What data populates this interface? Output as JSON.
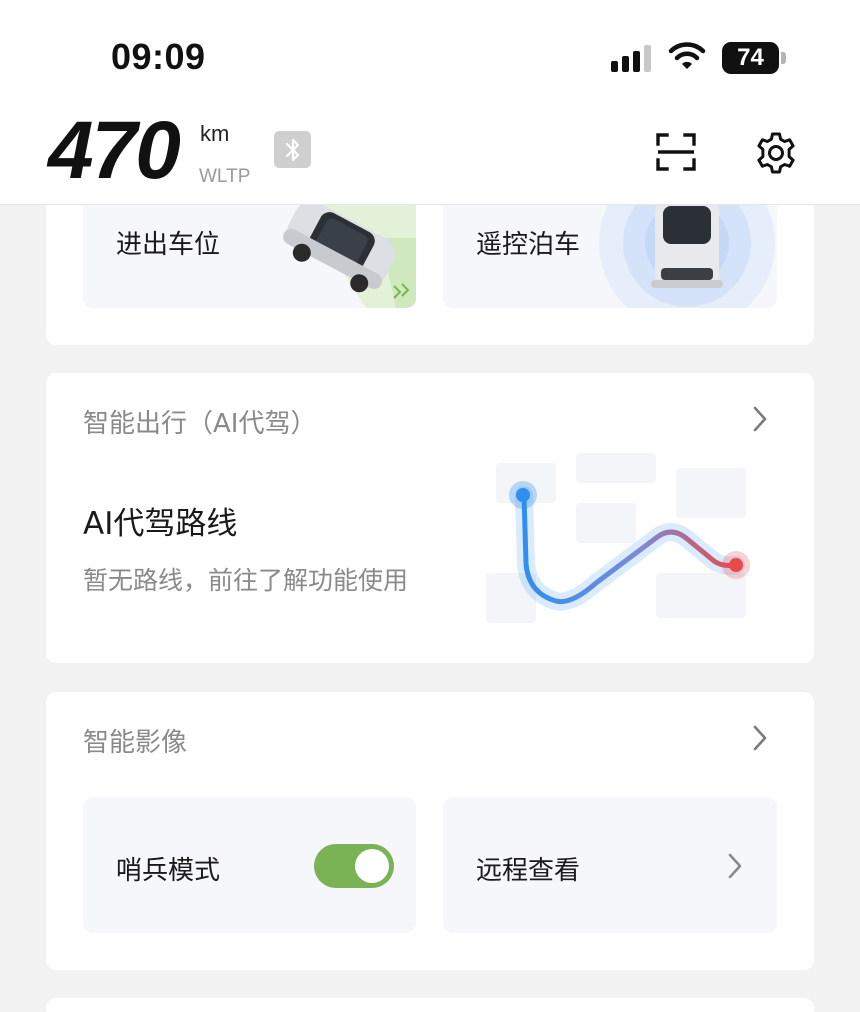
{
  "status_bar": {
    "time": "09:09",
    "battery_level": "74"
  },
  "header": {
    "range_value": "470",
    "range_unit": "km",
    "range_standard": "WLTP",
    "icons": [
      "bluetooth-icon",
      "scan-icon",
      "gear-icon"
    ]
  },
  "parking_card": {
    "tiles": [
      {
        "label": "进出车位"
      },
      {
        "label": "遥控泊车"
      }
    ]
  },
  "ai_drive_card": {
    "title": "智能出行（AI代驾）",
    "route_title": "AI代驾路线",
    "route_subtitle": "暂无路线，前往了解功能使用"
  },
  "camera_card": {
    "title": "智能影像",
    "sentry_label": "哨兵模式",
    "sentry_enabled": true,
    "remote_view_label": "远程查看"
  },
  "colors": {
    "accent_green": "#7ab356",
    "route_start": "#2f8ff0",
    "route_end": "#e84a4a",
    "page_bg": "#f2f2f2"
  }
}
